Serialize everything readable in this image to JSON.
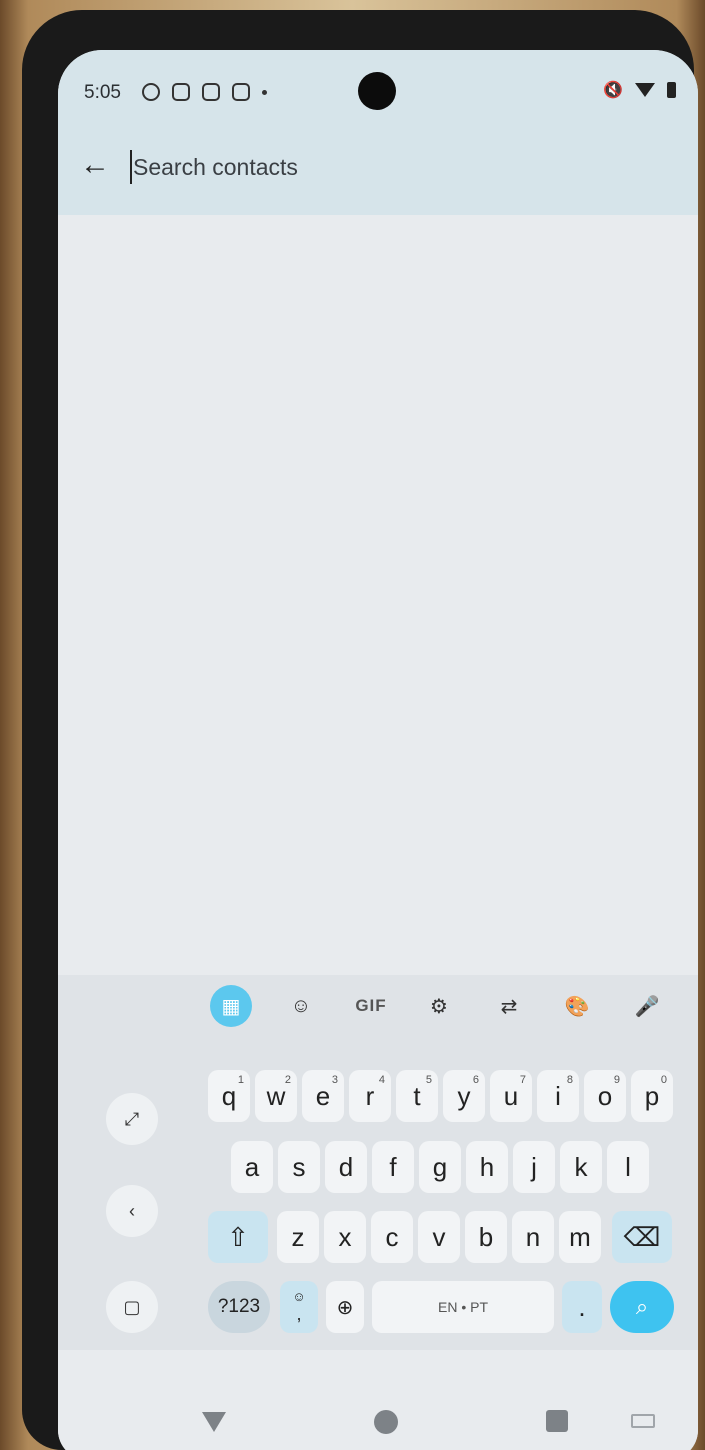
{
  "status_bar": {
    "time": "5:05"
  },
  "search": {
    "placeholder": "Search contacts",
    "value": ""
  },
  "keyboard": {
    "toolbar": {
      "gif_label": "GIF"
    },
    "row1": [
      {
        "key": "q",
        "hint": "1"
      },
      {
        "key": "w",
        "hint": "2"
      },
      {
        "key": "e",
        "hint": "3"
      },
      {
        "key": "r",
        "hint": "4"
      },
      {
        "key": "t",
        "hint": "5"
      },
      {
        "key": "y",
        "hint": "6"
      },
      {
        "key": "u",
        "hint": "7"
      },
      {
        "key": "i",
        "hint": "8"
      },
      {
        "key": "o",
        "hint": "9"
      },
      {
        "key": "p",
        "hint": "0"
      }
    ],
    "row2": [
      "a",
      "s",
      "d",
      "f",
      "g",
      "h",
      "j",
      "k",
      "l"
    ],
    "row3": [
      "z",
      "x",
      "c",
      "v",
      "b",
      "n",
      "m"
    ],
    "symbols_label": "?123",
    "comma_label": ",",
    "space_label": "EN • PT",
    "period_label": "."
  },
  "colors": {
    "header_bg": "#d6e4ea",
    "accent": "#3ec3f0"
  }
}
